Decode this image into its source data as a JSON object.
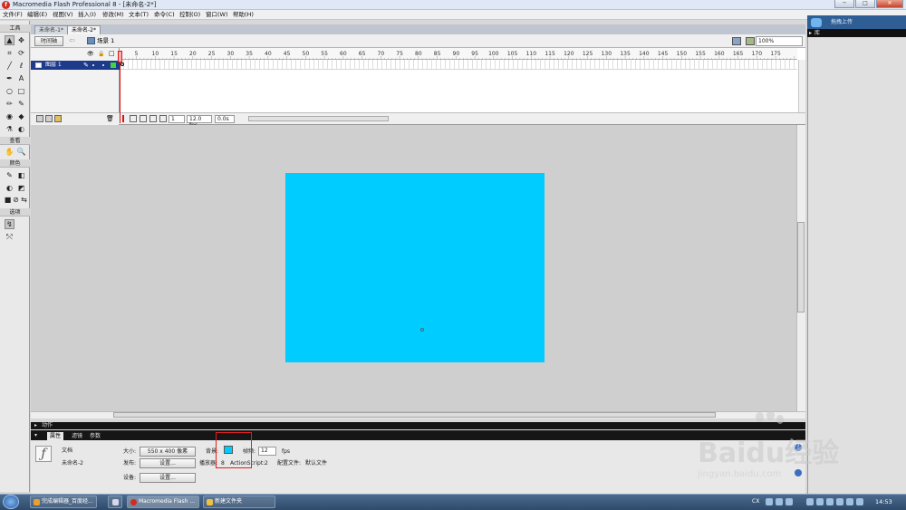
{
  "window": {
    "title": "Macromedia Flash Professional 8 - [未命名-2*]",
    "app_icon_letter": "f",
    "min_label": "─",
    "max_label": "□",
    "close_label": "✕"
  },
  "menu": [
    "文件(F)",
    "编辑(E)",
    "视图(V)",
    "插入(I)",
    "修改(M)",
    "文本(T)",
    "命令(C)",
    "控制(O)",
    "窗口(W)",
    "帮助(H)"
  ],
  "tools_panel": {
    "title": "工具",
    "view_title": "查看",
    "color_title": "颜色",
    "options_title": "选项",
    "tools": [
      "▲",
      "✥",
      "⌗",
      "⟳",
      "╱",
      "ℓ",
      "✒",
      "A",
      "○",
      "□",
      "✏",
      "✎",
      "◉",
      "◆",
      "⚗",
      "◐"
    ],
    "view_tools": [
      "✋",
      "🔍"
    ],
    "color_tools": [
      "✎",
      "◧",
      "◐",
      "◩"
    ],
    "mini_tools": [
      "■",
      "⊘",
      "⇆"
    ],
    "option_tools": [
      "↯",
      "⤲"
    ]
  },
  "document_tabs": [
    "未命名-1*",
    "未命名-2*"
  ],
  "edit_bar": {
    "timeline_button": "时间轴",
    "back_arrow": "⇦",
    "scene_label": "场景 1",
    "zoom": "100%"
  },
  "timeline": {
    "layer_name": "图层 1",
    "eye_icon": "👁",
    "lock_icon": "🔒",
    "outline_icon": "□",
    "frame_ticks": [
      "5",
      "10",
      "15",
      "20",
      "25",
      "30",
      "35",
      "40",
      "45",
      "50",
      "55",
      "60",
      "65",
      "70",
      "75",
      "80",
      "85",
      "90",
      "95",
      "100",
      "105",
      "110",
      "115",
      "120",
      "125",
      "130",
      "135",
      "140",
      "145",
      "150",
      "155",
      "160",
      "165",
      "170",
      "175"
    ],
    "current_frame": "1",
    "fps": "12.0 fps",
    "elapsed": "0.0s",
    "trash_icon": "🗑"
  },
  "actions_panel": {
    "label": "动作"
  },
  "properties_panel": {
    "tabs": [
      "属性",
      "滤镜",
      "参数"
    ],
    "doc_label": "文档",
    "doc_name": "未命名-2",
    "size_label": "大小:",
    "size_value": "550 x 400 像素",
    "background_label": "背景:",
    "background_color": "#00ccff",
    "framerate_label": "帧频:",
    "framerate_value": "12",
    "fps_unit": "fps",
    "publish_label": "发布:",
    "settings_button": "设置...",
    "player_label": "播放器:",
    "player_value": "8",
    "actionscript_label": "ActionScript:",
    "actionscript_value": "2",
    "profile_label": "配置文件:",
    "profile_value": "默认文件",
    "device_label": "设备:",
    "device_button": "设置..."
  },
  "right_panel": {
    "title": "拖拽上传",
    "library_label": "库"
  },
  "stage": {
    "background_color": "#00ccff"
  },
  "taskbar": {
    "tasks": [
      "完成编辑器_百度经...",
      "",
      "Macromedia Flash ...",
      "新建文件夹"
    ],
    "language": "CX",
    "clock": "14:53"
  },
  "watermark": {
    "main": "Baidu经验",
    "sub": "jingyan.baidu.com"
  }
}
